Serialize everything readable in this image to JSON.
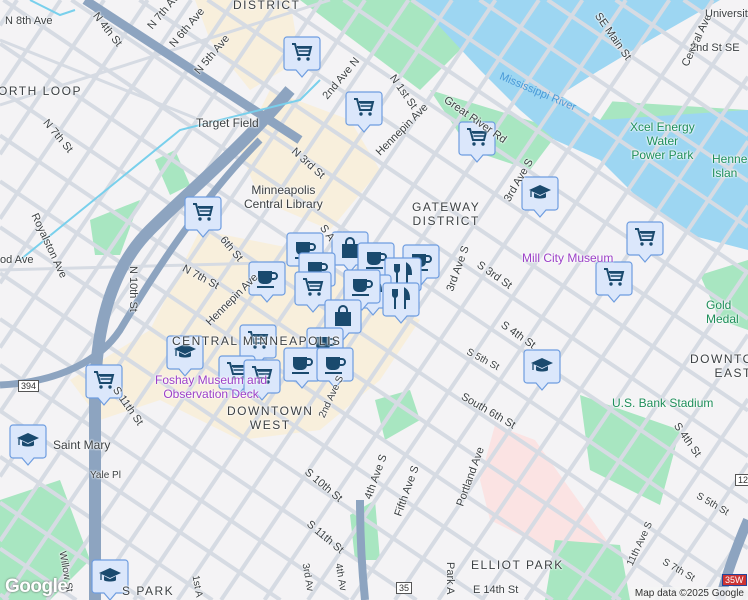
{
  "map": {
    "districts": {
      "warehouse": "DISTRICT",
      "north_loop": "ORTH LOOP",
      "gateway": "GATEWAY\nDISTRICT",
      "central": "CENTRAL MINNEAPOLIS",
      "downtown_west": "DOWNTOWN\nWEST",
      "downtown_east": "DOWNTOWN\nEAST",
      "elliot_park": "ELLIOT PARK",
      "loring_park": "S PARK"
    },
    "streets": {
      "n8thave": "N 8th Ave",
      "n4thst": "N 4th St",
      "n7thave": "N 7th Ave",
      "n6thave": "N 6th Ave",
      "n5thave": "N 5th Ave",
      "n7thst_a": "N 7th St",
      "n3rdst": "N 3rd St",
      "royalston": "Royalston Ave",
      "odave": "od Ave",
      "n10thst": "N 10th St",
      "n7thst_b": "N 7th St",
      "sixthst": "6th St",
      "hennepin_a": "Hennepin Ave",
      "ave2n": "2nd Ave N",
      "n1stst": "N 1st St",
      "hennepin_b": "Hennepin Ave",
      "greatriver": "Great River Rd",
      "semain": "SE Main St",
      "central": "Central Ave",
      "university": "University",
      "second_se": "2nd St SE",
      "ave3s_a": "3rd Ave S",
      "ave3s_b": "3rd Ave S",
      "s3rdst": "S 3rd St",
      "s4thst_a": "S 4th St",
      "s5thst_a": "S 5th St",
      "south6th": "South 6th St",
      "portland": "Portland Ave",
      "fifthave": "Fifth Ave S",
      "ave4s": "4th Ave S",
      "s4thst_b": "S 4th St",
      "s5thst_b": "S 5th St",
      "ave11s": "11th Ave S",
      "s7thst": "S 7th St",
      "e14th": "E 14th St",
      "parkave": "Park A",
      "s11thst_a": "S 11th St",
      "yale": "Yale Pl",
      "s10thst": "S 10th St",
      "s11thst_b": "S 11th St",
      "ave2s": "2nd Ave S",
      "willow": "Willow St",
      "ave3s_c": "3rd Av",
      "ave4s_c": "4th Av",
      "ave1s": "1st A",
      "sa": "S A"
    },
    "water": {
      "river": "Mississippi River"
    },
    "pois": {
      "target_field": "Target Field",
      "library": "Minneapolis\nCentral Library",
      "xcel": "Xcel Energy\nWater\nPower Park",
      "hennepin_island": "Henne\nIslan",
      "mill_city": "Mill City Museum",
      "gold_medal": "Gold\nMedal",
      "usbank": "U.S. Bank Stadium",
      "foshay": "Foshay Museum and\nObservation Deck",
      "saint_mary": "Saint Mary"
    },
    "shields": {
      "i394": "394",
      "i35": "35",
      "i35w": "35W",
      "us12": "12"
    },
    "attribution": "Map data ©2025 Google",
    "logo": "Google"
  },
  "colors": {
    "background": "#f4f3f5",
    "road": "#d6dbe3",
    "freeway": "#8da4c0",
    "water": "#9dd6f2",
    "park": "#a8e6c1",
    "commercial": "#f8efdc",
    "medical": "#fbe3e3",
    "marker_fill": "#dbe7fb",
    "marker_border": "#6e9de0",
    "marker_icon": "#1a4a6e"
  },
  "marker_icons": [
    "cart-icon",
    "graduation-cap-icon",
    "coffee-icon",
    "shopping-bag-icon",
    "restaurant-icon"
  ]
}
